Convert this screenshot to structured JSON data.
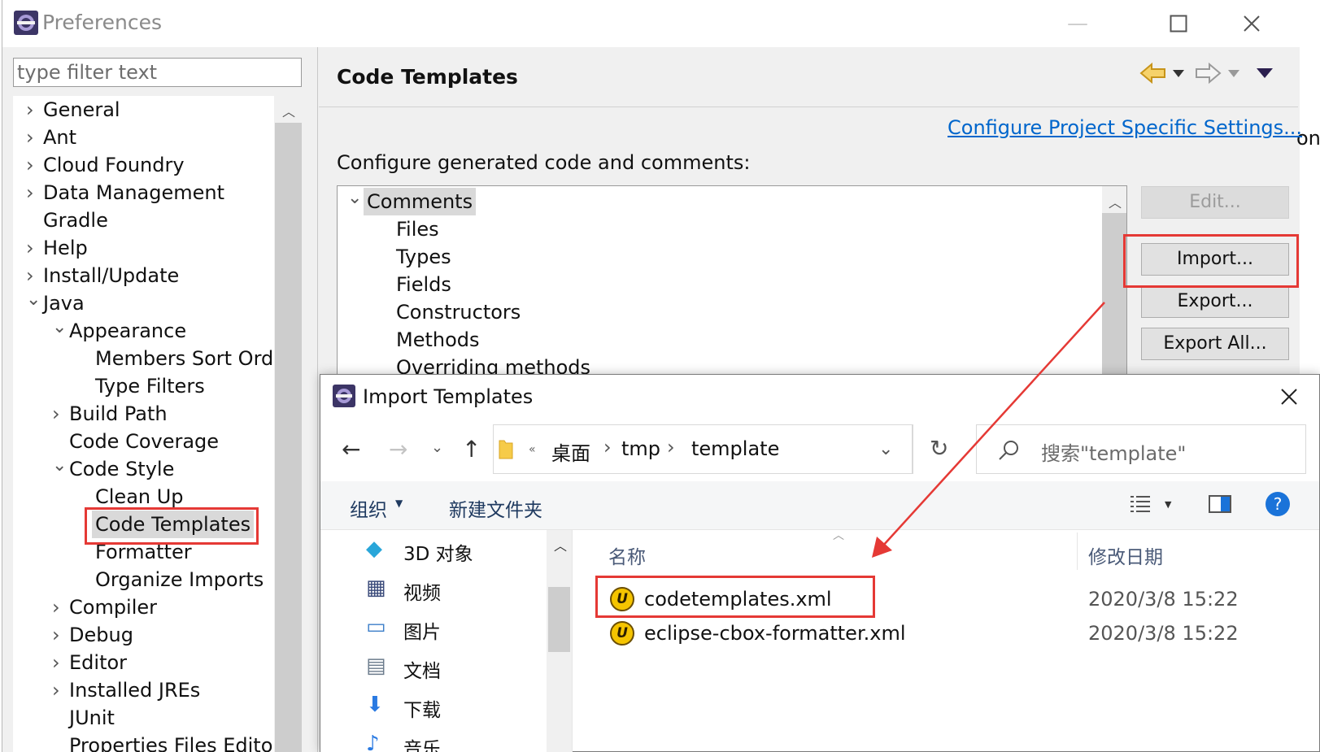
{
  "preferences": {
    "title": "Preferences",
    "filter_placeholder": "type filter text",
    "nav": [
      {
        "label": "General",
        "expander": "collapsed"
      },
      {
        "label": "Ant",
        "expander": "collapsed"
      },
      {
        "label": "Cloud Foundry",
        "expander": "collapsed"
      },
      {
        "label": "Data Management",
        "expander": "collapsed"
      },
      {
        "label": "Gradle",
        "expander": "none"
      },
      {
        "label": "Help",
        "expander": "collapsed"
      },
      {
        "label": "Install/Update",
        "expander": "collapsed"
      },
      {
        "label": "Java",
        "expander": "expanded"
      },
      {
        "label": "Appearance",
        "expander": "expanded"
      },
      {
        "label": "Members Sort Orde",
        "expander": "none"
      },
      {
        "label": "Type Filters",
        "expander": "none"
      },
      {
        "label": "Build Path",
        "expander": "collapsed"
      },
      {
        "label": "Code Coverage",
        "expander": "none"
      },
      {
        "label": "Code Style",
        "expander": "expanded"
      },
      {
        "label": "Clean Up",
        "expander": "none"
      },
      {
        "label": "Code Templates",
        "expander": "none",
        "selected": true
      },
      {
        "label": "Formatter",
        "expander": "none"
      },
      {
        "label": "Organize Imports",
        "expander": "none"
      },
      {
        "label": "Compiler",
        "expander": "collapsed"
      },
      {
        "label": "Debug",
        "expander": "collapsed"
      },
      {
        "label": "Editor",
        "expander": "collapsed"
      },
      {
        "label": "Installed JREs",
        "expander": "collapsed"
      },
      {
        "label": "JUnit",
        "expander": "none"
      },
      {
        "label": "Properties Files Editor",
        "expander": "none"
      }
    ],
    "page": {
      "title": "Code Templates",
      "project_link": "Configure Project Specific Settings...",
      "description": "Configure generated code and comments:",
      "templates": [
        {
          "label": "Comments",
          "expander": "expanded",
          "selected": true
        },
        {
          "label": "Files"
        },
        {
          "label": "Types"
        },
        {
          "label": "Fields"
        },
        {
          "label": "Constructors"
        },
        {
          "label": "Methods"
        },
        {
          "label": "Overriding methods"
        }
      ],
      "buttons": {
        "edit": "Edit...",
        "import": "Import...",
        "export": "Export...",
        "export_all": "Export All..."
      }
    },
    "edge_text": "on"
  },
  "dialog": {
    "title": "Import Templates",
    "breadcrumb": [
      "桌面",
      "tmp",
      "template"
    ],
    "search_placeholder": "搜索\"template\"",
    "commands": {
      "organize": "组织",
      "new_folder": "新建文件夹"
    },
    "sidebar": [
      {
        "label": "3D 对象",
        "icon": "3d-objects-icon"
      },
      {
        "label": "视频",
        "icon": "videos-icon"
      },
      {
        "label": "图片",
        "icon": "pictures-icon"
      },
      {
        "label": "文档",
        "icon": "documents-icon"
      },
      {
        "label": "下载",
        "icon": "downloads-icon"
      },
      {
        "label": "音乐",
        "icon": "music-icon"
      }
    ],
    "columns": {
      "name": "名称",
      "modified": "修改日期"
    },
    "files": [
      {
        "name": "codetemplates.xml",
        "modified": "2020/3/8 15:22",
        "icon": "ultraedit-file-icon"
      },
      {
        "name": "eclipse-cbox-formatter.xml",
        "modified": "2020/3/8 15:22",
        "icon": "ultraedit-file-icon"
      }
    ]
  },
  "colors": {
    "accent_red": "#e53935",
    "link_blue": "#0066cc",
    "help_blue": "#1a73d9"
  }
}
